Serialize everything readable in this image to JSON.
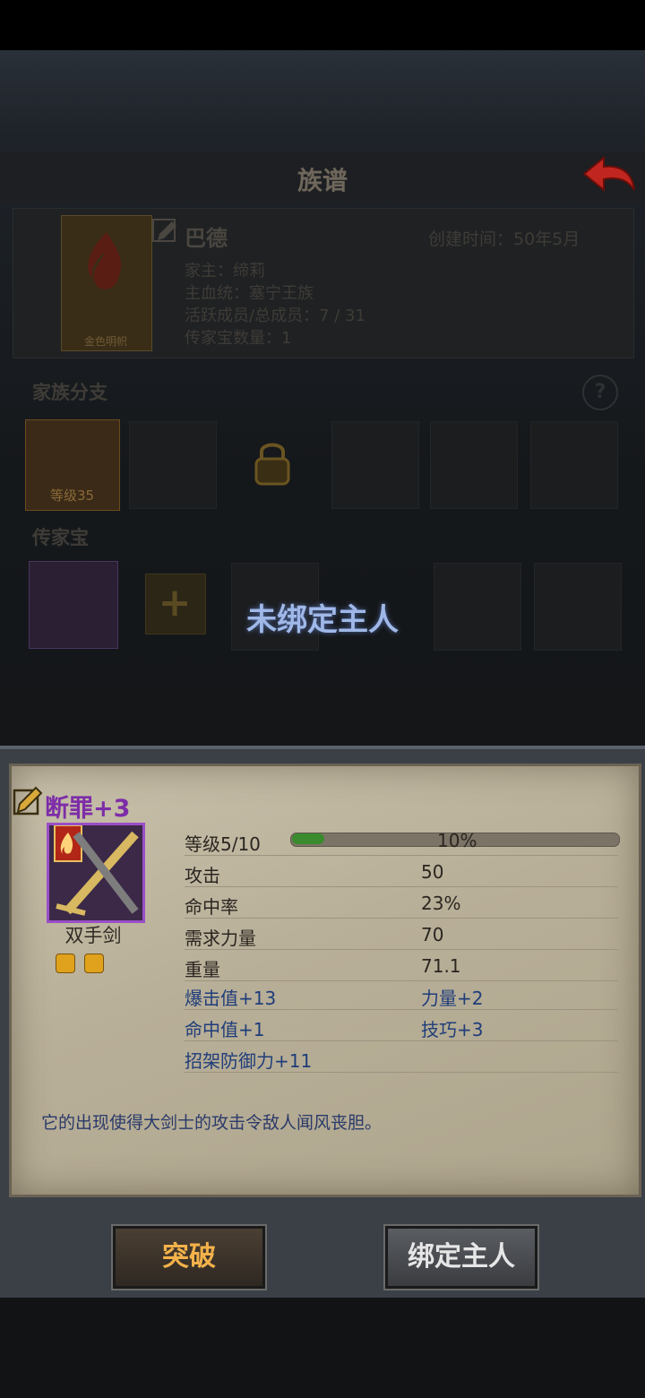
{
  "screen": {
    "title": "族谱",
    "overlay_text": "未绑定主人"
  },
  "family": {
    "banner_label": "金色明帜",
    "name": "巴德",
    "created": "创建时间：50年5月",
    "patriarch": "家主：缔莉",
    "bloodline": "主血统：塞宁王族",
    "members": "活跃成员/总成员：7 / 31",
    "heirloom_count": "传家宝数量：1",
    "branch_title": "家族分支",
    "member_level": "等级35",
    "heirloom_title": "传家宝"
  },
  "item": {
    "name": "断罪+3",
    "type": "双手剑",
    "level_label": "等级5/10",
    "xp_percent_text": "10%",
    "xp_fraction": 0.1,
    "stats": [
      {
        "label": "攻击",
        "value": "50"
      },
      {
        "label": "命中率",
        "value": "23%"
      },
      {
        "label": "需求力量",
        "value": "70"
      },
      {
        "label": "重量",
        "value": "71.1"
      }
    ],
    "bonuses": [
      {
        "left": "爆击值+13",
        "right": "力量+2"
      },
      {
        "left": "命中值+1",
        "right": "技巧+3"
      },
      {
        "left": "招架防御力+11",
        "right": ""
      }
    ],
    "description": "它的出现使得大剑士的攻击令敌人闻风丧胆。"
  },
  "buttons": {
    "breakthrough": "突破",
    "bind_owner": "绑定主人"
  },
  "icons": {
    "back": "back-arrow-icon",
    "edit": "pencil-icon",
    "help": "help-icon",
    "lock": "lock-icon",
    "add": "plus-icon",
    "gem": "gem-icon"
  },
  "colors": {
    "item_name": "#7d2da8",
    "button_primary_text": "#f3b24a",
    "overlay_text": "#9fb8e8"
  }
}
